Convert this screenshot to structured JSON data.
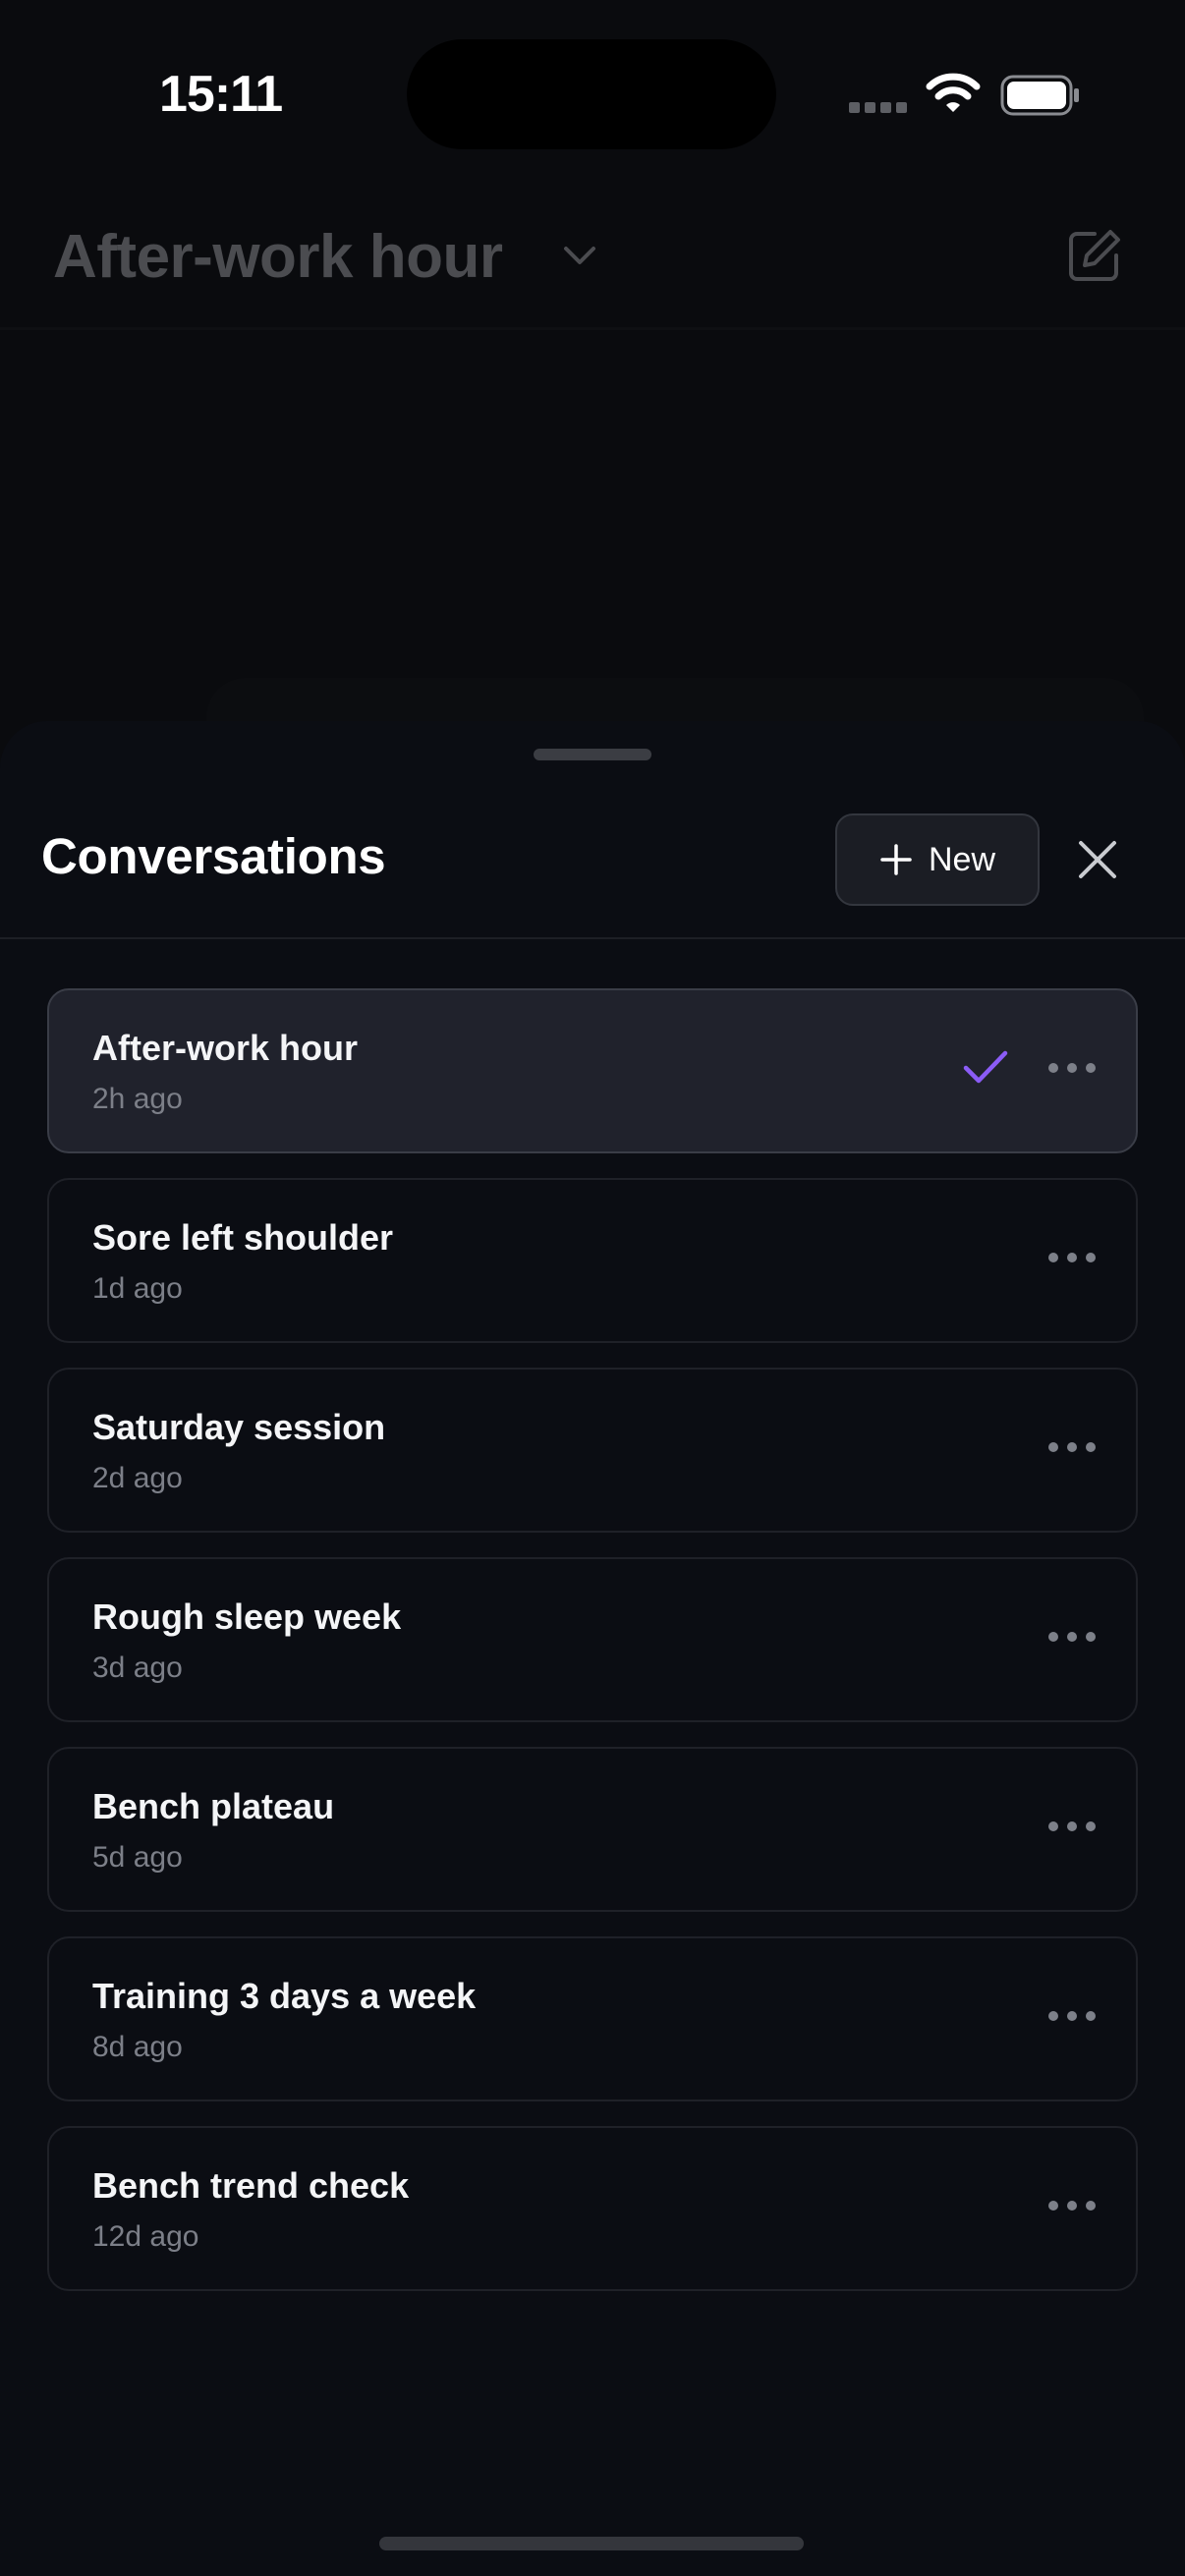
{
  "status_bar": {
    "time": "15:11",
    "signal_icon": "cellular-signal-icon",
    "wifi_icon": "wifi-icon",
    "battery_icon": "battery-full-icon"
  },
  "app_header": {
    "title": "After-work hour",
    "chevron_icon": "chevron-down-icon",
    "compose_icon": "compose-edit-icon"
  },
  "sheet": {
    "title": "Conversations",
    "new_button_label": "New",
    "new_icon": "plus-icon",
    "close_icon": "close-icon",
    "conversations": [
      {
        "title": "After-work hour",
        "time": "2h ago",
        "selected": true
      },
      {
        "title": "Sore left shoulder",
        "time": "1d ago",
        "selected": false
      },
      {
        "title": "Saturday session",
        "time": "2d ago",
        "selected": false
      },
      {
        "title": "Rough sleep week",
        "time": "3d ago",
        "selected": false
      },
      {
        "title": "Bench plateau",
        "time": "5d ago",
        "selected": false
      },
      {
        "title": "Training 3 days a week",
        "time": "8d ago",
        "selected": false
      },
      {
        "title": "Bench trend check",
        "time": "12d ago",
        "selected": false
      }
    ]
  },
  "colors": {
    "accent": "#8b5cf6",
    "background": "#0b0d13",
    "selected_row": "#20222c"
  }
}
